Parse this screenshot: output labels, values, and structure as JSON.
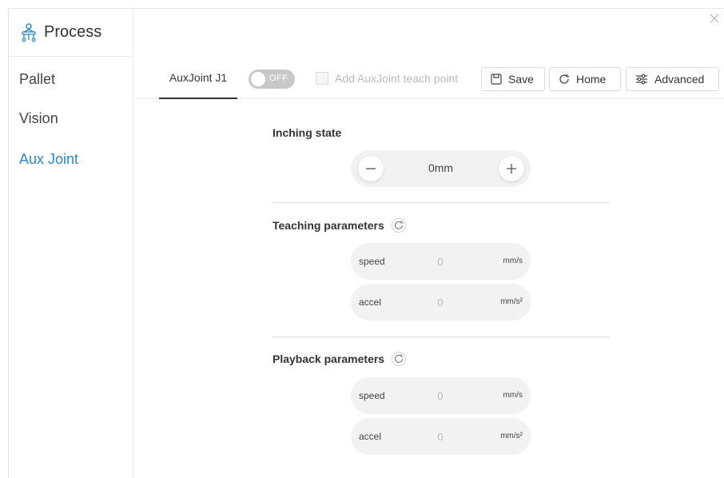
{
  "sidebar": {
    "title": "Process",
    "items": [
      {
        "label": "Pallet",
        "active": false
      },
      {
        "label": "Vision",
        "active": false
      },
      {
        "label": "Aux Joint",
        "active": true
      }
    ]
  },
  "tabs": {
    "active_label": "AuxJoint J1"
  },
  "toolbar": {
    "toggle_label": "OFF",
    "checkbox_label": "Add AuxJoint teach point",
    "save_label": "Save",
    "home_label": "Home",
    "advanced_label": "Advanced"
  },
  "inching": {
    "title": "Inching state",
    "value": "0mm"
  },
  "teaching": {
    "title": "Teaching parameters",
    "speed": {
      "label": "speed",
      "value": "0",
      "unit": "mm/s"
    },
    "accel": {
      "label": "accel",
      "value": "0",
      "unit": "mm/s²"
    }
  },
  "playback": {
    "title": "Playback parameters",
    "speed": {
      "label": "speed",
      "value": "0",
      "unit": "mm/s"
    },
    "accel": {
      "label": "accel",
      "value": "0",
      "unit": "mm/s²"
    }
  },
  "colors": {
    "accent": "#2b87c8",
    "toggle_off": "#c8c8c8",
    "field_bg": "#f2f2f2"
  }
}
